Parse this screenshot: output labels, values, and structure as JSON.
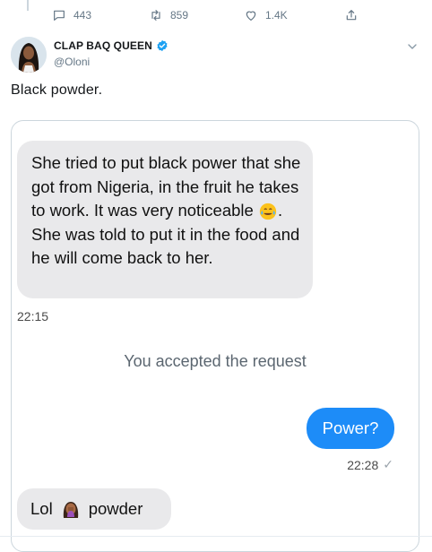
{
  "actions": {
    "reply_count": "443",
    "retweet_count": "859",
    "like_count": "1.4K",
    "reply_icon": "reply-icon",
    "retweet_icon": "retweet-icon",
    "like_icon": "heart-icon",
    "share_icon": "share-icon"
  },
  "author": {
    "display_name": "CLAP BAQ QUEEN",
    "handle": "@Oloni",
    "verified": true
  },
  "tweet": {
    "text": "Black powder."
  },
  "chat": {
    "message1": "She tried to put black power that she got from Nigeria, in the fruit he takes to work. It was very noticeable",
    "message1_emoji": "face-with-tears-of-joy",
    "message1_tail": ". She was told to put it in the food and he will come back to her.",
    "time1": "22:15",
    "system_message": "You accepted the request",
    "sent_message": "Power?",
    "time2": "22:28",
    "time2_status": "✓",
    "message3_prefix": "Lol",
    "message3_emoji": "woman-facepalming",
    "message3_suffix": "powder"
  },
  "colors": {
    "accent": "#1d8cf8",
    "verified": "#1da1f2",
    "muted": "#657786",
    "bubble_in": "#e9e9eb"
  }
}
